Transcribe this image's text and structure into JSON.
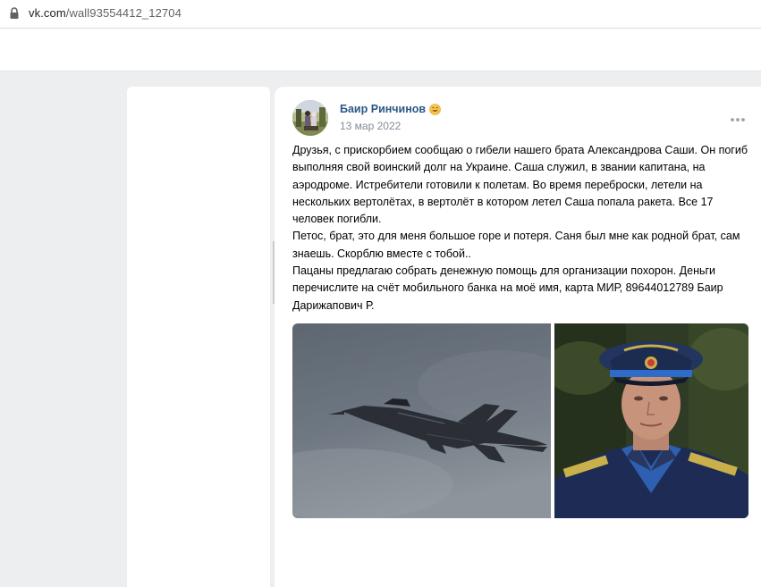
{
  "browser": {
    "url_host": "vk.com",
    "url_path": "/wall93554412_12704"
  },
  "post": {
    "author": "Баир Ринчинов",
    "author_emoji": "smiling-emoji",
    "date": "13 мар 2022",
    "paragraphs": [
      "Друзья, с прискорбием сообщаю о гибели нашего брата Александрова Саши. Он погиб выполняя свой воинский долг на Украине. Саша служил, в звании капитана, на аэродроме. Истребители готовили к полетам. Во время переброски, летели на нескольких вертолётах, в вертолёт в котором летел Саша попала ракета. Все 17 человек погибли.",
      "Петос, брат, это для меня большое горе и потеря. Саня был мне как родной брат, сам знаешь. Скорблю вместе с тобой..",
      "Пацаны предлагаю собрать денежную помощь для организации похорон. Деньги перечислите на счёт мобильного банка на моё имя, карта МИР, 89644012789 Баир Дарижапович Р."
    ],
    "photos": [
      {
        "subject": "fighter jet in flight against grey sky"
      },
      {
        "subject": "man in military uniform and officer cap"
      }
    ]
  },
  "colors": {
    "page_background": "#edeef0",
    "author_link": "#2a5885",
    "date_text": "#818c99"
  }
}
